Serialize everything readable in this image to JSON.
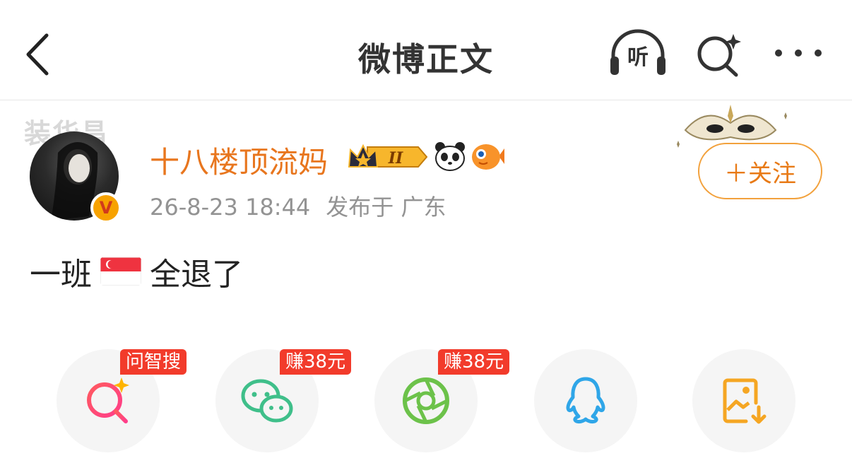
{
  "header": {
    "title": "微博正文",
    "listen_label": "听"
  },
  "author": {
    "avatar_deco_text": "装华昌",
    "name": "十八楼顶流妈",
    "badge_level": "II",
    "timestamp": "26-8-23 18:44",
    "location": "发布于 广东",
    "verified_mark": "V",
    "follow_label": "＋关注"
  },
  "post": {
    "text_before": "一班",
    "text_after": "全退了",
    "flag_icon": "singapore-flag-icon"
  },
  "share": {
    "items": [
      {
        "icon": "ai-search-icon",
        "tag": "问智搜"
      },
      {
        "icon": "wechat-icon",
        "tag": "赚38元"
      },
      {
        "icon": "moments-icon",
        "tag": "赚38元"
      },
      {
        "icon": "qq-icon",
        "tag": ""
      },
      {
        "icon": "save-image-icon",
        "tag": ""
      }
    ]
  },
  "colors": {
    "accent": "#e8761e",
    "tag_red": "#f23b2b",
    "meta_gray": "#939393"
  }
}
